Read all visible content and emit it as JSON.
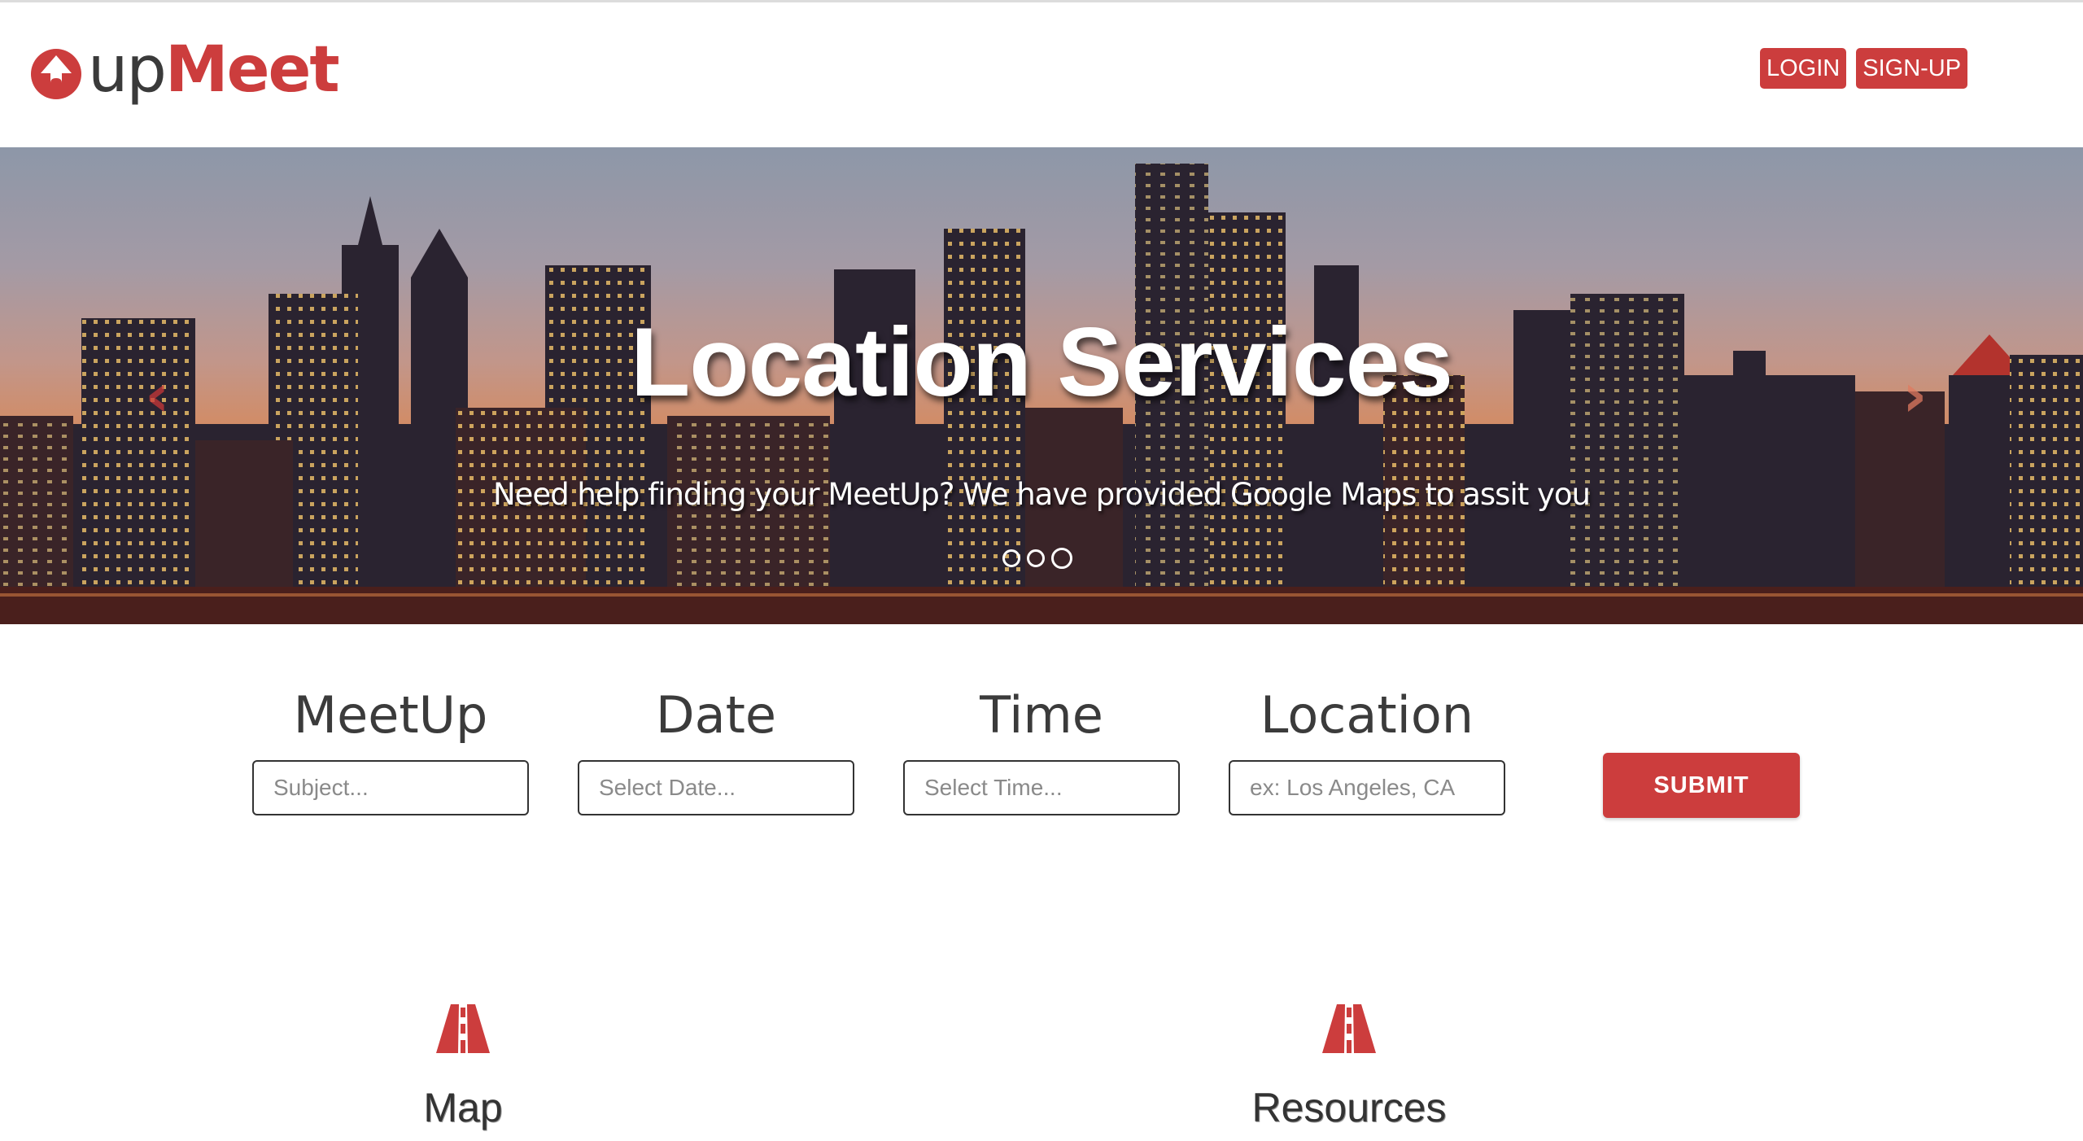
{
  "brand": {
    "name_part1": "up",
    "name_part2": "Meet",
    "icon": "arrow-up-circle-icon",
    "color": "#cc3d3d"
  },
  "auth": {
    "login_label": "LOGIN",
    "signup_label": "SIGN-UP"
  },
  "hero": {
    "title": "Location Services",
    "subtitle": "Need help finding your MeetUp? We have provided Google Maps to assit you",
    "slides": 3,
    "active_slide": 3,
    "prev_icon": "chevron-left-icon",
    "next_icon": "chevron-right-icon"
  },
  "form": {
    "meetup": {
      "label": "MeetUp",
      "placeholder": "Subject..."
    },
    "date": {
      "label": "Date",
      "placeholder": "Select Date..."
    },
    "time": {
      "label": "Time",
      "placeholder": "Select Time..."
    },
    "location": {
      "label": "Location",
      "placeholder": "ex: Los Angeles, CA"
    },
    "submit_label": "SUBMIT"
  },
  "features": [
    {
      "title": "Map",
      "icon": "road-icon"
    },
    {
      "title": "Resources",
      "icon": "road-icon"
    }
  ]
}
